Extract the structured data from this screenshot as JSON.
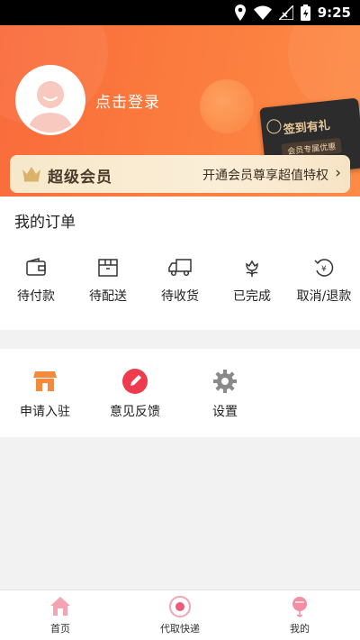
{
  "status_bar": {
    "time": "9:25",
    "icons": [
      "location-icon",
      "wifi-icon",
      "no-signal-icon",
      "battery-charging-icon"
    ]
  },
  "header": {
    "login_text": "点击登录",
    "checkin": {
      "title": "签到有礼",
      "subtitle": "会员专属优惠"
    }
  },
  "vip": {
    "title": "超级会员",
    "promo": "开通会员尊享超值特权",
    "chevron": "›"
  },
  "orders": {
    "title": "我的订单",
    "items": [
      {
        "label": "待付款",
        "icon": "wallet-icon"
      },
      {
        "label": "待配送",
        "icon": "package-icon"
      },
      {
        "label": "待收货",
        "icon": "truck-icon"
      },
      {
        "label": "已完成",
        "icon": "flower-icon"
      },
      {
        "label": "取消/退款",
        "icon": "refund-icon"
      }
    ]
  },
  "tools": {
    "items": [
      {
        "label": "申请入驻",
        "icon": "shop-icon",
        "color": "#f58a3a"
      },
      {
        "label": "意见反馈",
        "icon": "pencil-icon",
        "color": "#ee3b4e"
      },
      {
        "label": "设置",
        "icon": "gear-icon",
        "color": "#8a8a8a"
      }
    ]
  },
  "tabbar": {
    "items": [
      {
        "label": "首页",
        "icon": "home-icon"
      },
      {
        "label": "代取快递",
        "icon": "delivery-icon"
      },
      {
        "label": "我的",
        "icon": "profile-icon",
        "active": true
      }
    ]
  },
  "colors": {
    "header": "#f96a3c",
    "vip_bg": "#f6e8c9",
    "accent_red": "#ee3b4e"
  }
}
